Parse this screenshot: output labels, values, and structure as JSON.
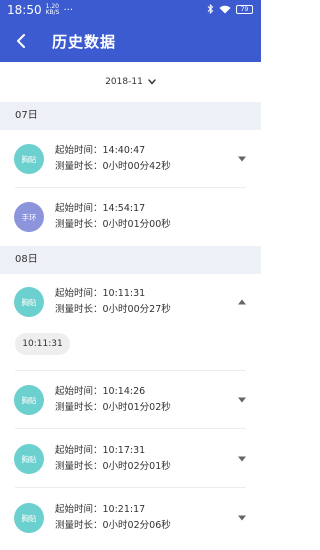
{
  "status_bar": {
    "time": "18:50",
    "network_speed_top": "1.20",
    "network_speed_bottom": "KB/S",
    "more": "···",
    "battery": "79"
  },
  "header": {
    "back_icon": "chevron-left-icon",
    "title": "历史数据"
  },
  "month_selector": {
    "value": "2018-11",
    "icon": "chevron-down-icon"
  },
  "labels": {
    "start_time": "起始时间：",
    "duration": "测量时长："
  },
  "colors": {
    "header": "#3c5bd0",
    "chest_badge": "#6cd0cf",
    "wrist_badge": "#8c94dc",
    "day_header_bg": "#eef0f7"
  },
  "days": [
    {
      "label": "07日",
      "records": [
        {
          "device": "胸贴",
          "start_time": "14:40:47",
          "duration": "0小时00分42秒",
          "expanded": false
        },
        {
          "device": "手环",
          "start_time": "14:54:17",
          "duration": "0小时01分00秒",
          "expanded": false
        }
      ]
    },
    {
      "label": "08日",
      "records": [
        {
          "device": "胸贴",
          "start_time": "10:11:31",
          "duration": "0小时00分27秒",
          "expanded": true,
          "times": [
            "10:11:31"
          ]
        },
        {
          "device": "胸贴",
          "start_time": "10:14:26",
          "duration": "0小时01分02秒",
          "expanded": false
        },
        {
          "device": "胸贴",
          "start_time": "10:17:31",
          "duration": "0小时02分01秒",
          "expanded": false
        },
        {
          "device": "胸贴",
          "start_time": "10:21:17",
          "duration": "0小时02分06秒",
          "expanded": false
        }
      ]
    }
  ]
}
